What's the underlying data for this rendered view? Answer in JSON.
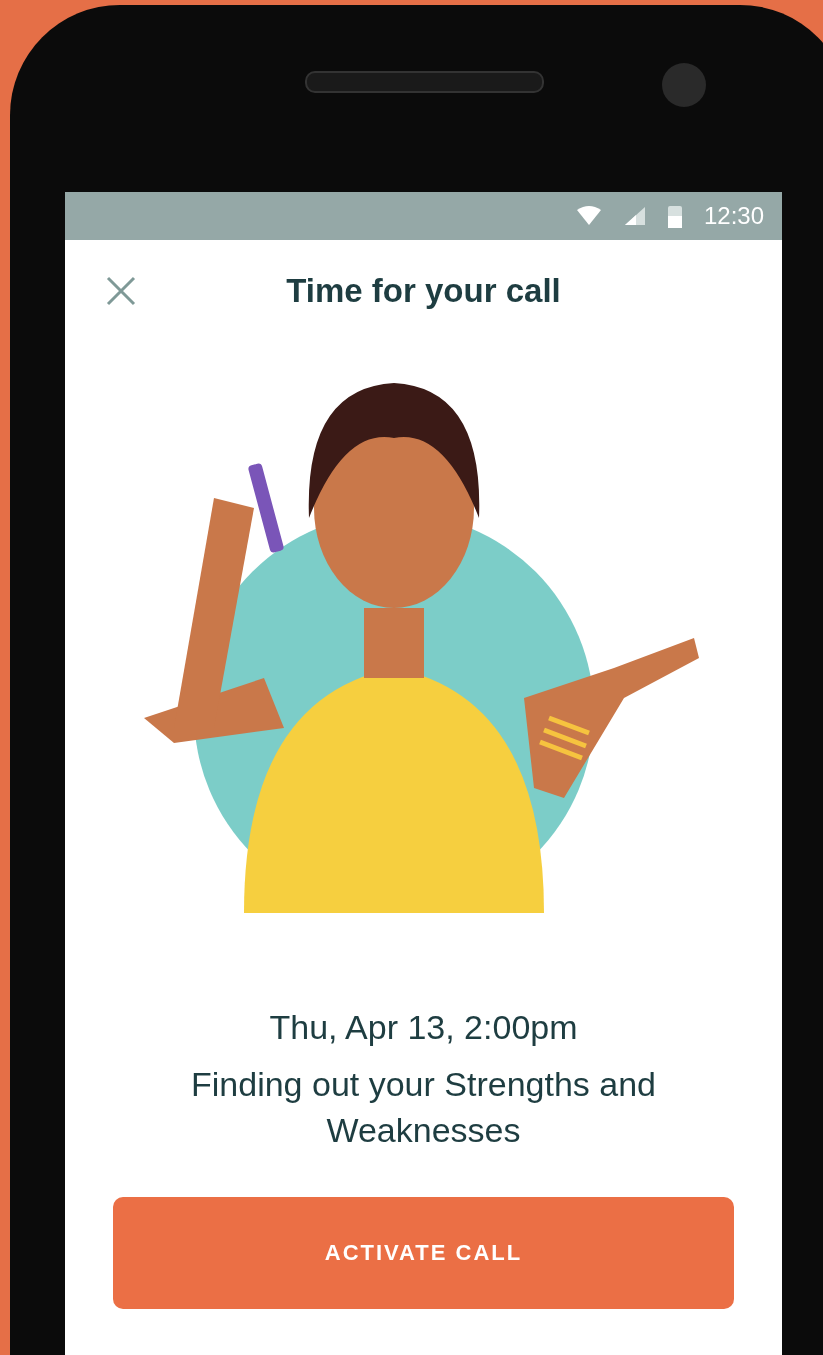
{
  "status_bar": {
    "time": "12:30"
  },
  "header": {
    "title": "Time for your call"
  },
  "call": {
    "datetime": "Thu, Apr 13, 2:00pm",
    "topic": "Finding out your Strengths and Weaknesses"
  },
  "button": {
    "label": "ACTIVATE CALL"
  }
}
